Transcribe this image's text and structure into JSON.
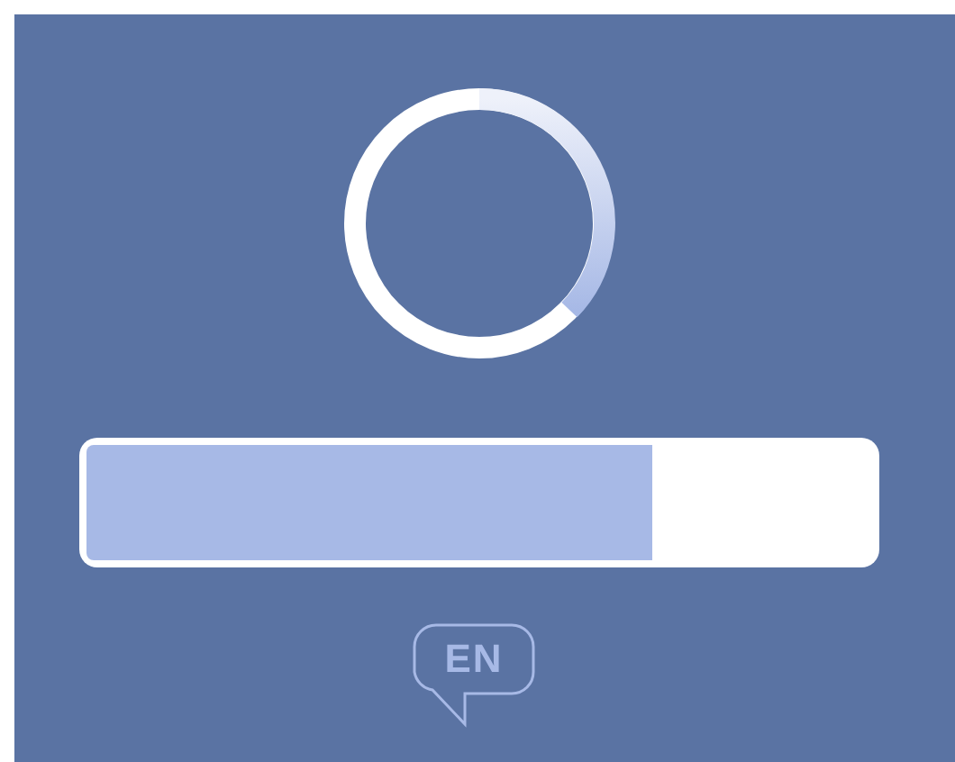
{
  "progress": {
    "level": 0.72
  },
  "language": {
    "label": "EN"
  }
}
